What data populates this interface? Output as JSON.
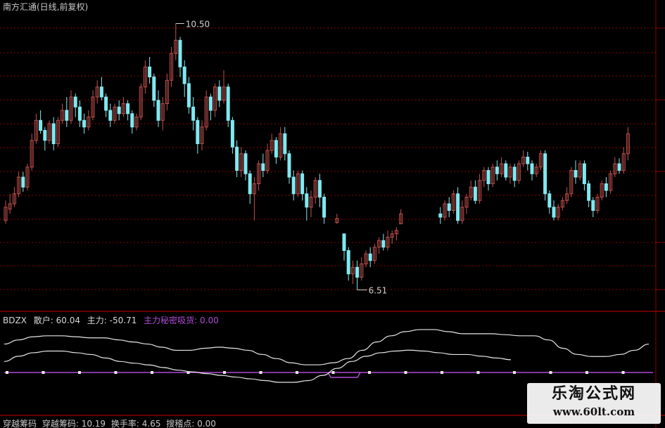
{
  "title": "南方汇通(日线,前复权)",
  "colors": {
    "up": "#c0504d",
    "down": "#7fe9f0",
    "line_white": "#e6e6e6",
    "purple": "#b04bd8",
    "grid": "#8b0000"
  },
  "indicator": {
    "name": "BDZX",
    "retail_label": "散户: 60.04",
    "main_label": "主力: -50.71",
    "absorb_label": "主力秘密吸货: 0.00"
  },
  "bottom_indicator": {
    "name_label": "穿越筹码",
    "value_label": "穿越筹码: 10.19",
    "turnover_label": "换手率: 4.65",
    "breakout_label": "搜稽点: 0.00"
  },
  "watermark": {
    "text": "乐淘公式网",
    "url": "www.60lt.com"
  },
  "chart_data": {
    "type": "candlestick",
    "annotations": [
      {
        "text": "10.50",
        "kind": "high"
      },
      {
        "text": "6.51",
        "kind": "low"
      }
    ],
    "price_range": [
      6.51,
      10.5
    ],
    "candles": [
      {
        "o": 7.55,
        "c": 7.75,
        "h": 7.85,
        "l": 7.5
      },
      {
        "o": 7.72,
        "c": 7.8,
        "h": 7.95,
        "l": 7.65
      },
      {
        "o": 7.8,
        "c": 7.95,
        "h": 8.05,
        "l": 7.75
      },
      {
        "o": 7.95,
        "c": 8.2,
        "h": 8.28,
        "l": 7.9
      },
      {
        "o": 8.2,
        "c": 8.05,
        "h": 8.28,
        "l": 7.98
      },
      {
        "o": 8.05,
        "c": 8.35,
        "h": 8.4,
        "l": 8.0
      },
      {
        "o": 8.35,
        "c": 8.75,
        "h": 8.85,
        "l": 8.3
      },
      {
        "o": 8.75,
        "c": 9.05,
        "h": 9.15,
        "l": 8.7
      },
      {
        "o": 9.05,
        "c": 8.9,
        "h": 9.2,
        "l": 8.85
      },
      {
        "o": 8.9,
        "c": 8.75,
        "h": 8.95,
        "l": 8.6
      },
      {
        "o": 8.75,
        "c": 9.0,
        "h": 9.05,
        "l": 8.7
      },
      {
        "o": 9.0,
        "c": 8.7,
        "h": 9.1,
        "l": 8.6
      },
      {
        "o": 8.7,
        "c": 9.05,
        "h": 9.1,
        "l": 8.65
      },
      {
        "o": 9.05,
        "c": 9.2,
        "h": 9.3,
        "l": 9.0
      },
      {
        "o": 9.2,
        "c": 9.05,
        "h": 9.4,
        "l": 8.95
      },
      {
        "o": 9.05,
        "c": 9.4,
        "h": 9.5,
        "l": 9.0
      },
      {
        "o": 9.4,
        "c": 9.25,
        "h": 9.45,
        "l": 9.1
      },
      {
        "o": 9.25,
        "c": 9.05,
        "h": 9.35,
        "l": 8.95
      },
      {
        "o": 9.05,
        "c": 8.95,
        "h": 9.15,
        "l": 8.85
      },
      {
        "o": 8.95,
        "c": 9.1,
        "h": 9.2,
        "l": 8.9
      },
      {
        "o": 9.1,
        "c": 9.4,
        "h": 9.5,
        "l": 9.05
      },
      {
        "o": 9.4,
        "c": 9.55,
        "h": 9.65,
        "l": 9.3
      },
      {
        "o": 9.55,
        "c": 9.4,
        "h": 9.7,
        "l": 9.35
      },
      {
        "o": 9.4,
        "c": 9.2,
        "h": 9.45,
        "l": 9.1
      },
      {
        "o": 9.2,
        "c": 9.05,
        "h": 9.3,
        "l": 8.95
      },
      {
        "o": 9.05,
        "c": 9.25,
        "h": 9.3,
        "l": 9.0
      },
      {
        "o": 9.25,
        "c": 9.15,
        "h": 9.35,
        "l": 9.05
      },
      {
        "o": 9.15,
        "c": 9.3,
        "h": 9.4,
        "l": 9.1
      },
      {
        "o": 9.3,
        "c": 9.15,
        "h": 9.35,
        "l": 9.05
      },
      {
        "o": 9.15,
        "c": 8.95,
        "h": 9.2,
        "l": 8.85
      },
      {
        "o": 8.95,
        "c": 9.1,
        "h": 9.15,
        "l": 8.9
      },
      {
        "o": 9.1,
        "c": 9.55,
        "h": 9.6,
        "l": 9.05
      },
      {
        "o": 9.55,
        "c": 9.85,
        "h": 9.95,
        "l": 9.45
      },
      {
        "o": 9.85,
        "c": 9.7,
        "h": 10.0,
        "l": 9.6
      },
      {
        "o": 9.7,
        "c": 9.35,
        "h": 9.75,
        "l": 9.25
      },
      {
        "o": 9.35,
        "c": 9.05,
        "h": 9.5,
        "l": 8.95
      },
      {
        "o": 9.05,
        "c": 9.3,
        "h": 9.4,
        "l": 8.9
      },
      {
        "o": 9.3,
        "c": 9.65,
        "h": 9.75,
        "l": 9.2
      },
      {
        "o": 9.65,
        "c": 10.05,
        "h": 10.15,
        "l": 9.55
      },
      {
        "o": 10.05,
        "c": 10.25,
        "h": 10.5,
        "l": 9.95
      },
      {
        "o": 10.25,
        "c": 9.85,
        "h": 10.3,
        "l": 9.7
      },
      {
        "o": 9.85,
        "c": 9.6,
        "h": 9.95,
        "l": 9.4
      },
      {
        "o": 9.6,
        "c": 9.25,
        "h": 9.7,
        "l": 9.15
      },
      {
        "o": 9.25,
        "c": 9.05,
        "h": 9.4,
        "l": 8.9
      },
      {
        "o": 9.05,
        "c": 8.7,
        "h": 9.1,
        "l": 8.55
      },
      {
        "o": 8.7,
        "c": 8.95,
        "h": 9.05,
        "l": 8.6
      },
      {
        "o": 8.95,
        "c": 9.4,
        "h": 9.5,
        "l": 8.9
      },
      {
        "o": 9.4,
        "c": 9.2,
        "h": 9.45,
        "l": 9.05
      },
      {
        "o": 9.2,
        "c": 9.55,
        "h": 9.6,
        "l": 9.1
      },
      {
        "o": 9.55,
        "c": 9.35,
        "h": 9.65,
        "l": 9.25
      },
      {
        "o": 9.35,
        "c": 9.55,
        "h": 9.8,
        "l": 9.3
      },
      {
        "o": 9.55,
        "c": 9.05,
        "h": 9.6,
        "l": 8.95
      },
      {
        "o": 9.05,
        "c": 8.65,
        "h": 9.1,
        "l": 8.55
      },
      {
        "o": 8.65,
        "c": 8.3,
        "h": 8.75,
        "l": 8.2
      },
      {
        "o": 8.3,
        "c": 8.55,
        "h": 8.65,
        "l": 8.2
      },
      {
        "o": 8.55,
        "c": 8.25,
        "h": 8.6,
        "l": 8.15
      },
      {
        "o": 8.25,
        "c": 7.95,
        "h": 8.3,
        "l": 7.8
      },
      {
        "o": 7.95,
        "c": 8.1,
        "h": 8.2,
        "l": 7.55
      },
      {
        "o": 8.1,
        "c": 8.4,
        "h": 8.45,
        "l": 8.0
      },
      {
        "o": 8.4,
        "c": 8.3,
        "h": 8.55,
        "l": 8.2
      },
      {
        "o": 8.3,
        "c": 8.6,
        "h": 8.7,
        "l": 8.25
      },
      {
        "o": 8.6,
        "c": 8.75,
        "h": 8.85,
        "l": 8.55
      },
      {
        "o": 8.75,
        "c": 8.5,
        "h": 8.8,
        "l": 8.4
      },
      {
        "o": 8.5,
        "c": 8.85,
        "h": 8.95,
        "l": 8.45
      },
      {
        "o": 8.85,
        "c": 8.55,
        "h": 8.95,
        "l": 8.45
      },
      {
        "o": 8.55,
        "c": 8.2,
        "h": 8.6,
        "l": 8.1
      },
      {
        "o": 8.2,
        "c": 7.95,
        "h": 8.3,
        "l": 7.85
      },
      {
        "o": 7.95,
        "c": 8.25,
        "h": 8.3,
        "l": 7.9
      },
      {
        "o": 8.25,
        "c": 7.95,
        "h": 8.3,
        "l": 7.85
      },
      {
        "o": 7.95,
        "c": 7.75,
        "h": 8.05,
        "l": 7.55
      },
      {
        "o": 7.75,
        "c": 7.9,
        "h": 8.0,
        "l": 7.6
      },
      {
        "o": 7.9,
        "c": 8.15,
        "h": 8.2,
        "l": 7.8
      },
      {
        "o": 8.15,
        "c": 7.9,
        "h": 8.25,
        "l": 7.75
      },
      {
        "o": 7.9,
        "c": 7.6,
        "h": 7.95,
        "l": 7.5
      },
      {
        "o": 7.52,
        "c": 7.58,
        "h": 7.65,
        "l": 7.5
      },
      {
        "o": 7.35,
        "c": 7.1,
        "h": 7.35,
        "l": 6.95
      },
      {
        "o": 7.1,
        "c": 6.75,
        "h": 7.15,
        "l": 6.65
      },
      {
        "o": 6.75,
        "c": 6.85,
        "h": 6.95,
        "l": 6.6
      },
      {
        "o": 6.85,
        "c": 6.7,
        "h": 6.95,
        "l": 6.51
      },
      {
        "o": 6.7,
        "c": 6.9,
        "h": 7.0,
        "l": 6.65
      },
      {
        "o": 6.9,
        "c": 7.05,
        "h": 7.1,
        "l": 6.85
      },
      {
        "o": 7.05,
        "c": 6.95,
        "h": 7.15,
        "l": 6.85
      },
      {
        "o": 6.95,
        "c": 7.15,
        "h": 7.2,
        "l": 6.9
      },
      {
        "o": 7.15,
        "c": 7.25,
        "h": 7.3,
        "l": 7.05
      },
      {
        "o": 7.25,
        "c": 7.15,
        "h": 7.35,
        "l": 7.1
      },
      {
        "o": 7.15,
        "c": 7.3,
        "h": 7.4,
        "l": 7.1
      },
      {
        "o": 7.3,
        "c": 7.35,
        "h": 7.4,
        "l": 7.2
      },
      {
        "o": 7.35,
        "c": 7.4,
        "h": 7.45,
        "l": 7.25
      },
      {
        "o": 7.5,
        "c": 7.65,
        "h": 7.72,
        "l": 7.5
      },
      {
        "o": 7.65,
        "c": 7.6,
        "h": 7.75,
        "l": 7.5
      },
      {
        "o": 7.6,
        "c": 7.8,
        "h": 7.85,
        "l": 7.55
      },
      {
        "o": 7.8,
        "c": 7.7,
        "h": 7.9,
        "l": 7.6
      },
      {
        "o": 7.7,
        "c": 7.95,
        "h": 8.0,
        "l": 7.65
      },
      {
        "o": 7.95,
        "c": 7.55,
        "h": 8.05,
        "l": 7.5
      },
      {
        "o": 7.55,
        "c": 7.75,
        "h": 7.85,
        "l": 7.5
      },
      {
        "o": 7.75,
        "c": 7.9,
        "h": 7.95,
        "l": 7.65
      },
      {
        "o": 7.9,
        "c": 8.05,
        "h": 8.15,
        "l": 7.85
      },
      {
        "o": 8.05,
        "c": 7.85,
        "h": 8.15,
        "l": 7.8
      },
      {
        "o": 7.85,
        "c": 8.15,
        "h": 8.25,
        "l": 7.8
      },
      {
        "o": 8.15,
        "c": 8.3,
        "h": 8.35,
        "l": 8.05
      },
      {
        "o": 8.3,
        "c": 8.1,
        "h": 8.35,
        "l": 8.0
      },
      {
        "o": 8.1,
        "c": 8.35,
        "h": 8.4,
        "l": 8.05
      },
      {
        "o": 8.35,
        "c": 8.25,
        "h": 8.45,
        "l": 8.15
      },
      {
        "o": 8.25,
        "c": 8.4,
        "h": 8.5,
        "l": 8.2
      },
      {
        "o": 8.4,
        "c": 8.2,
        "h": 8.45,
        "l": 8.15
      },
      {
        "o": 8.2,
        "c": 8.35,
        "h": 8.4,
        "l": 8.1
      },
      {
        "o": 8.35,
        "c": 8.15,
        "h": 8.4,
        "l": 8.05
      },
      {
        "o": 8.15,
        "c": 8.4,
        "h": 8.45,
        "l": 8.1
      },
      {
        "o": 8.4,
        "c": 8.5,
        "h": 8.6,
        "l": 8.35
      },
      {
        "o": 8.5,
        "c": 8.4,
        "h": 8.58,
        "l": 8.3
      },
      {
        "o": 8.4,
        "c": 8.25,
        "h": 8.45,
        "l": 8.15
      },
      {
        "o": 8.25,
        "c": 8.35,
        "h": 8.4,
        "l": 8.2
      },
      {
        "o": 8.35,
        "c": 8.55,
        "h": 8.6,
        "l": 8.3
      },
      {
        "o": 8.55,
        "c": 7.95,
        "h": 8.6,
        "l": 7.85
      },
      {
        "o": 7.95,
        "c": 7.75,
        "h": 8.0,
        "l": 7.65
      },
      {
        "o": 7.75,
        "c": 7.6,
        "h": 7.85,
        "l": 7.55
      },
      {
        "o": 7.6,
        "c": 7.75,
        "h": 7.8,
        "l": 7.55
      },
      {
        "o": 7.75,
        "c": 7.85,
        "h": 7.9,
        "l": 7.7
      },
      {
        "o": 7.85,
        "c": 7.95,
        "h": 8.05,
        "l": 7.8
      },
      {
        "o": 7.95,
        "c": 8.3,
        "h": 8.35,
        "l": 7.9
      },
      {
        "o": 8.3,
        "c": 8.2,
        "h": 8.45,
        "l": 8.1
      },
      {
        "o": 8.2,
        "c": 8.4,
        "h": 8.45,
        "l": 8.15
      },
      {
        "o": 8.4,
        "c": 8.1,
        "h": 8.45,
        "l": 8.0
      },
      {
        "o": 8.1,
        "c": 7.85,
        "h": 8.15,
        "l": 7.75
      },
      {
        "o": 7.85,
        "c": 7.7,
        "h": 7.9,
        "l": 7.6
      },
      {
        "o": 7.7,
        "c": 7.9,
        "h": 7.95,
        "l": 7.65
      },
      {
        "o": 7.9,
        "c": 8.1,
        "h": 8.15,
        "l": 7.85
      },
      {
        "o": 8.1,
        "c": 8.0,
        "h": 8.2,
        "l": 7.9
      },
      {
        "o": 8.0,
        "c": 8.25,
        "h": 8.3,
        "l": 7.95
      },
      {
        "o": 8.25,
        "c": 8.4,
        "h": 8.5,
        "l": 8.2
      },
      {
        "o": 8.4,
        "c": 8.3,
        "h": 8.48,
        "l": 8.25
      },
      {
        "o": 8.3,
        "c": 8.55,
        "h": 8.65,
        "l": 8.25
      },
      {
        "o": 8.55,
        "c": 8.85,
        "h": 8.95,
        "l": 8.45
      }
    ],
    "gaps_after": [
      73,
      74,
      88
    ],
    "retail_line": [
      58,
      62,
      65,
      66,
      66,
      65,
      64,
      64,
      62,
      60,
      58,
      55,
      52,
      52,
      54,
      55,
      54,
      52,
      48,
      44,
      40,
      38,
      38,
      40,
      44,
      52,
      60,
      66,
      70,
      72,
      72,
      70,
      68,
      68,
      68,
      67,
      66,
      66,
      62,
      54,
      48,
      46,
      46,
      48,
      52,
      58
    ],
    "main_line": [
      -62,
      -68,
      -72,
      -74,
      -74,
      -72,
      -70,
      -66,
      -62,
      -60,
      -58,
      -55,
      -52,
      -50,
      -48,
      -46,
      -44,
      -42,
      -40,
      -38,
      -38,
      -40,
      -46,
      -54,
      -62,
      -68,
      -72,
      -74,
      -75,
      -74,
      -72,
      -70,
      -70,
      -68,
      -66,
      -64
    ]
  }
}
